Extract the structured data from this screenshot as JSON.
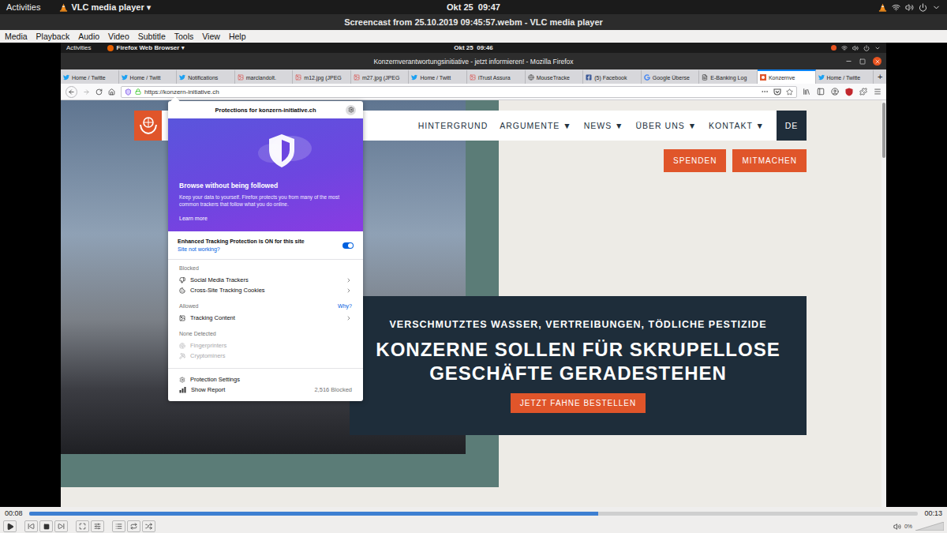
{
  "desktop_bar": {
    "activities": "Activities",
    "app": "VLC media player ▾",
    "clock": "Okt 25  09:47"
  },
  "window": {
    "title": "Screencast from 25.10.2019 09:45:57.webm - VLC media player"
  },
  "menu": [
    "Media",
    "Playback",
    "Audio",
    "Video",
    "Subtitle",
    "Tools",
    "View",
    "Help"
  ],
  "video": {
    "desktop_bar": {
      "activities": "Activities",
      "app": "Firefox Web Browser ▾",
      "clock": "Okt 25  09:46"
    },
    "browser": {
      "title": "Konzernverantwortungsinitiative - jetzt informieren! - Mozilla Firefox",
      "tabs": [
        {
          "label": "Home / Twitte",
          "kind": "twitter",
          "selected": false
        },
        {
          "label": "Home / Twitt",
          "kind": "twitter",
          "selected": false
        },
        {
          "label": "Notifications",
          "kind": "twitter",
          "selected": false
        },
        {
          "label": "marclandolt.",
          "kind": "image",
          "selected": false
        },
        {
          "label": "m12.jpg (JPEG",
          "kind": "image",
          "selected": false
        },
        {
          "label": "m27.jpg (JPEG",
          "kind": "image",
          "selected": false
        },
        {
          "label": "Home / Twitt",
          "kind": "twitter",
          "selected": false
        },
        {
          "label": "iTrust Assura",
          "kind": "image",
          "selected": false
        },
        {
          "label": "MouseTracke",
          "kind": "page",
          "selected": false
        },
        {
          "label": "(5) Facebook",
          "kind": "facebook",
          "selected": false
        },
        {
          "label": "Google Überse",
          "kind": "google",
          "selected": false
        },
        {
          "label": "E-Banking Log",
          "kind": "bank",
          "selected": false
        },
        {
          "label": "Konzernve",
          "kind": "site",
          "selected": true
        },
        {
          "label": "Home / Twitte",
          "kind": "twitter",
          "selected": false
        }
      ],
      "new_tab": "+",
      "url": "https://konzern-initiative.ch",
      "page": {
        "nav": [
          "HINTERGRUND",
          "ARGUMENTE ▼",
          "NEWS ▼",
          "ÜBER UNS ▼",
          "KONTAKT ▼"
        ],
        "language": "DE",
        "buttons": [
          "SPENDEN",
          "MITMACHEN"
        ],
        "hero": {
          "kicker": "VERSCHMUTZTES WASSER, VERTREIBUNGEN, TÖDLICHE PESTIZIDE",
          "title_lines": [
            "KONZERNE SOLLEN FÜR SKRUPELLOSE",
            "GESCHÄFTE GERADESTEHEN"
          ],
          "button": "JETZT FAHNE BESTELLEN"
        }
      },
      "protections": {
        "title": "Protections for konzern-initiative.ch",
        "hero_title": "Browse without being followed",
        "hero_text": "Keep your data to yourself. Firefox protects you from many of the most common trackers that follow what you do online.",
        "learn_more": "Learn more",
        "etp_label": "Enhanced Tracking Protection is ON for this site",
        "etp_on": true,
        "site_not_working": "Site not working?",
        "sections": [
          {
            "label": "Blocked",
            "link": "",
            "items": [
              {
                "label": "Social Media Trackers",
                "kind": "social",
                "disabled": false,
                "expandable": true
              },
              {
                "label": "Cross-Site Tracking Cookies",
                "kind": "cookie",
                "disabled": false,
                "expandable": true
              }
            ]
          },
          {
            "label": "Allowed",
            "link": "Why?",
            "items": [
              {
                "label": "Tracking Content",
                "kind": "content",
                "disabled": false,
                "expandable": true
              }
            ]
          },
          {
            "label": "None Detected",
            "link": "",
            "items": [
              {
                "label": "Fingerprinters",
                "kind": "fingerprint",
                "disabled": true,
                "expandable": false
              },
              {
                "label": "Cryptominers",
                "kind": "miner",
                "disabled": true,
                "expandable": false
              }
            ]
          }
        ],
        "footer": [
          {
            "label": "Protection Settings",
            "kind": "settings",
            "count": ""
          },
          {
            "label": "Show Report",
            "kind": "report",
            "count": "2,516 Blocked"
          }
        ]
      }
    }
  },
  "player": {
    "elapsed": "00:08",
    "total": "00:13",
    "level": 0.64,
    "volume": "0%",
    "volume_level": 0,
    "playing": false
  }
}
